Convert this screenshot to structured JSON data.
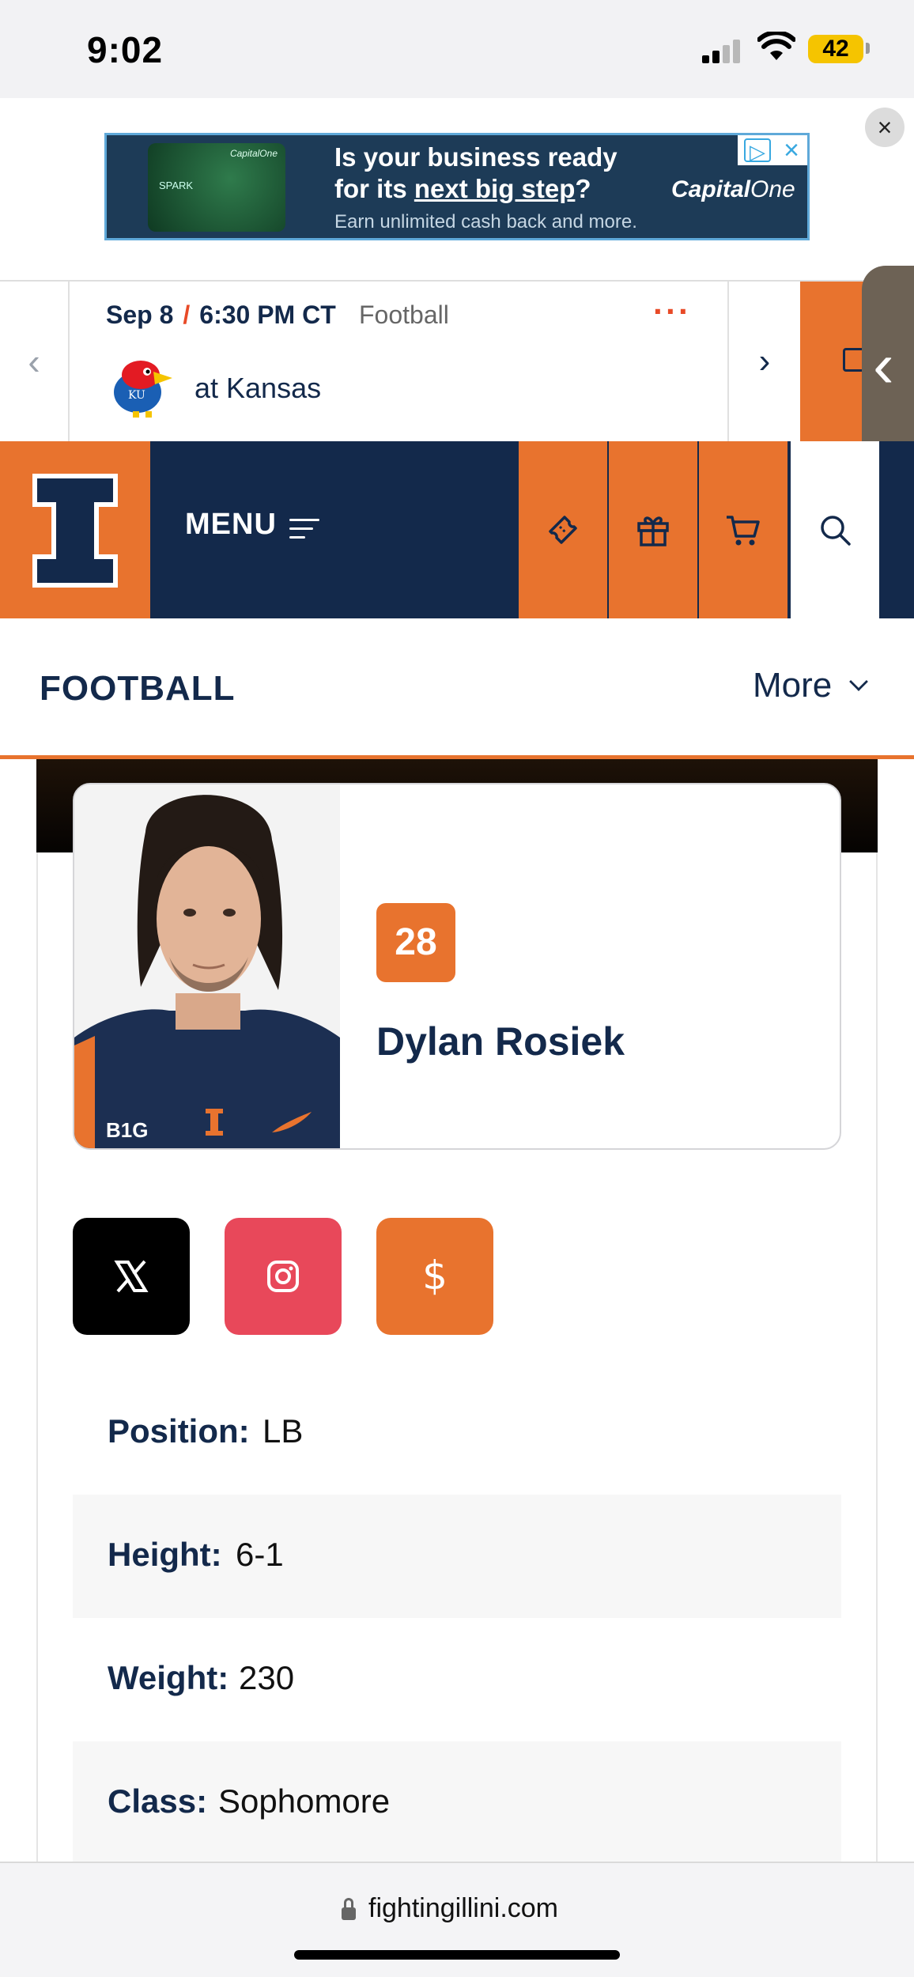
{
  "status_bar": {
    "time": "9:02",
    "battery": "42"
  },
  "ad": {
    "headline_1": "Is your business ready",
    "headline_2a": "for its ",
    "headline_2b": "next big step",
    "headline_2c": "?",
    "subtext": "Earn unlimited cash back and more.",
    "brand_a": "Capital",
    "brand_b": "One",
    "card_brand": "CapitalOne",
    "card_text": "SPARK"
  },
  "schedule": {
    "date": "Sep 8",
    "time": "6:30 PM CT",
    "sport": "Football",
    "more": "···",
    "opponent": "at Kansas"
  },
  "nav": {
    "menu_label": "MENU"
  },
  "section": {
    "title": "FOOTBALL",
    "more_label": "More"
  },
  "player": {
    "number": "28",
    "name": "Dylan Rosiek",
    "stats": [
      {
        "label": "Position:",
        "value": "LB"
      },
      {
        "label": "Height:",
        "value": "6-1"
      },
      {
        "label": "Weight:",
        "value": "230"
      },
      {
        "label": "Class:",
        "value": "Sophomore"
      }
    ]
  },
  "social": {
    "x_color": "#000000",
    "instagram_color": "#e8485a",
    "nil_color": "#e8732e",
    "nil_symbol": "$"
  },
  "browser": {
    "url": "fightingillini.com"
  },
  "colors": {
    "navy": "#13294b",
    "orange": "#e8732e"
  }
}
